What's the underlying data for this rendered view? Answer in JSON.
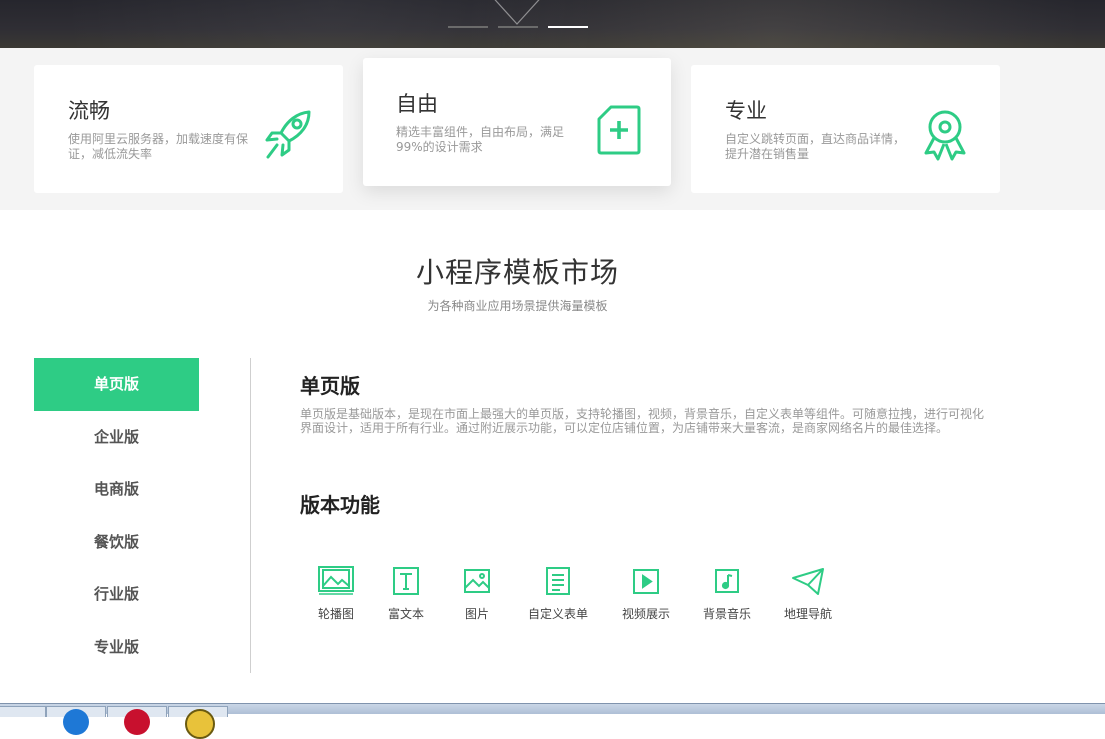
{
  "hero": {
    "slides": 3,
    "active_slide": 3
  },
  "features": [
    {
      "title": "流畅",
      "desc": "使用阿里云服务器，加载速度有保证，减低流失率",
      "icon": "rocket-icon"
    },
    {
      "title": "自由",
      "desc": "精选丰富组件，自由布局，满足99%的设计需求",
      "icon": "file-plus-icon"
    },
    {
      "title": "专业",
      "desc": "自定义跳转页面，直达商品详情，提升潜在销售量",
      "icon": "award-icon"
    }
  ],
  "market": {
    "title": "小程序模板市场",
    "subtitle": "为各种商业应用场景提供海量模板"
  },
  "nav": {
    "items": [
      "单页版",
      "企业版",
      "电商版",
      "餐饮版",
      "行业版",
      "专业版"
    ],
    "active_index": 0
  },
  "panel": {
    "title": "单页版",
    "desc": "单页版是基础版本，是现在市面上最强大的单页版，支持轮播图，视频，背景音乐，自定义表单等组件。可随意拉拽，进行可视化界面设计，适用于所有行业。通过附近展示功能，可以定位店铺位置，为店铺带来大量客流，是商家网络名片的最佳选择。",
    "functions_title": "版本功能",
    "functions": [
      {
        "label": "轮播图",
        "icon": "carousel-icon"
      },
      {
        "label": "富文本",
        "icon": "rich-text-icon"
      },
      {
        "label": "图片",
        "icon": "image-icon"
      },
      {
        "label": "自定义表单",
        "icon": "form-icon"
      },
      {
        "label": "视频展示",
        "icon": "video-icon"
      },
      {
        "label": "背景音乐",
        "icon": "music-icon"
      },
      {
        "label": "地理导航",
        "icon": "navigation-icon"
      }
    ]
  },
  "colors": {
    "accent": "#2ecc85",
    "text": "#333333",
    "muted": "#999999",
    "strip_bg": "#f4f4f4"
  }
}
